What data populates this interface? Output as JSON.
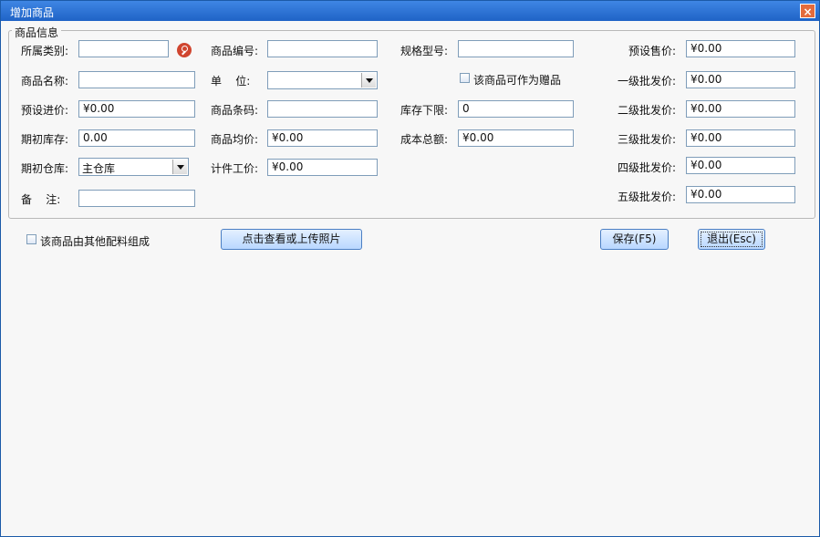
{
  "window": {
    "title": "增加商品"
  },
  "group": {
    "title": "商品信息"
  },
  "col1": [
    {
      "label": "所属类别:",
      "value": ""
    },
    {
      "label": "商品名称:",
      "value": ""
    },
    {
      "label": "预设进价:",
      "value": "¥0.00"
    },
    {
      "label": "期初库存:",
      "value": "0.00"
    },
    {
      "label": "期初仓库:",
      "value": "主仓库"
    },
    {
      "label": "备    注:",
      "value": ""
    }
  ],
  "col2": [
    {
      "label": "商品编号:",
      "value": ""
    },
    {
      "label": "单    位:",
      "value": ""
    },
    {
      "label": "商品条码:",
      "value": ""
    },
    {
      "label": "商品均价:",
      "value": "¥0.00"
    },
    {
      "label": "计件工价:",
      "value": "¥0.00"
    }
  ],
  "col3": [
    {
      "label": "规格型号:",
      "value": ""
    },
    {
      "label": "库存下限:",
      "value": "0"
    },
    {
      "label": "成本总额:",
      "value": "¥0.00"
    }
  ],
  "gift": {
    "label": "该商品可作为赠品",
    "checked": false
  },
  "col4": [
    {
      "label": "预设售价:",
      "value": "¥0.00"
    },
    {
      "label": "一级批发价:",
      "value": "¥0.00"
    },
    {
      "label": "二级批发价:",
      "value": "¥0.00"
    },
    {
      "label": "三级批发价:",
      "value": "¥0.00"
    },
    {
      "label": "四级批发价:",
      "value": "¥0.00"
    },
    {
      "label": "五级批发价:",
      "value": "¥0.00"
    }
  ],
  "composite": {
    "label": "该商品由其他配料组成",
    "checked": false
  },
  "buttons": {
    "photo": "点击查看或上传照片",
    "save": "保存(F5)",
    "exit": "退出(Esc)"
  },
  "icons": {
    "close": "close-icon",
    "search": "search-icon",
    "dropdown": "chevron-down-icon"
  }
}
